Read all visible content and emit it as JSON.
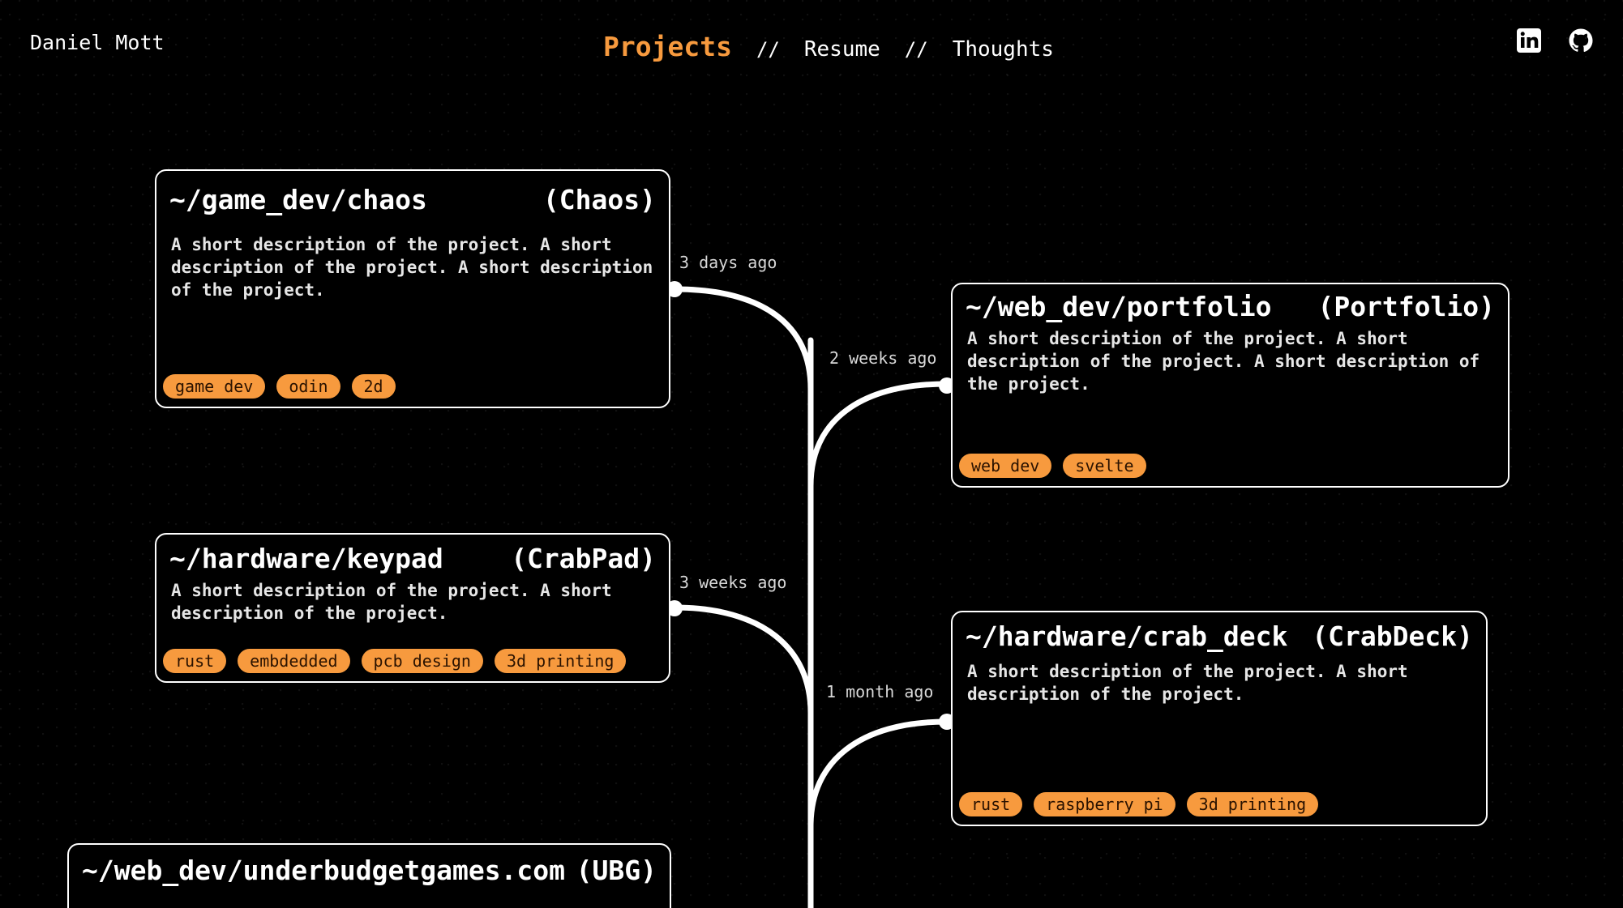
{
  "header": {
    "name": "Daniel Mott",
    "nav": {
      "projects": "Projects",
      "sep1": "//",
      "resume": "Resume",
      "sep2": "//",
      "thoughts": "Thoughts"
    },
    "socials": [
      "linkedin-icon",
      "github-icon"
    ]
  },
  "colors": {
    "accent": "#f79a3e",
    "background": "#000000",
    "line": "#ffffff"
  },
  "projects": [
    {
      "path": "~/game_dev/chaos",
      "name": "(Chaos)",
      "desc": "A short description of the project. A short description of the project. A short description of the project.",
      "ago": "3 days ago",
      "tags": [
        "game dev",
        "odin",
        "2d"
      ]
    },
    {
      "path": "~/web_dev/portfolio",
      "name": "(Portfolio)",
      "desc": "A short description of the project. A short description of the project. A short description of the project.",
      "ago": "2 weeks ago",
      "tags": [
        "web dev",
        "svelte"
      ]
    },
    {
      "path": "~/hardware/keypad",
      "name": "(CrabPad)",
      "desc": "A short description of the project. A short description of the project.",
      "ago": "3 weeks ago",
      "tags": [
        "rust",
        "embdedded",
        "pcb design",
        "3d printing"
      ]
    },
    {
      "path": "~/hardware/crab_deck",
      "name": "(CrabDeck)",
      "desc": "A short description of the project. A short description of the project.",
      "ago": "1 month ago",
      "tags": [
        "rust",
        "raspberry pi",
        "3d printing"
      ]
    },
    {
      "path": "~/web_dev/underbudgetgames.com",
      "name": "(UBG)",
      "desc": "",
      "ago": "",
      "tags": []
    }
  ]
}
